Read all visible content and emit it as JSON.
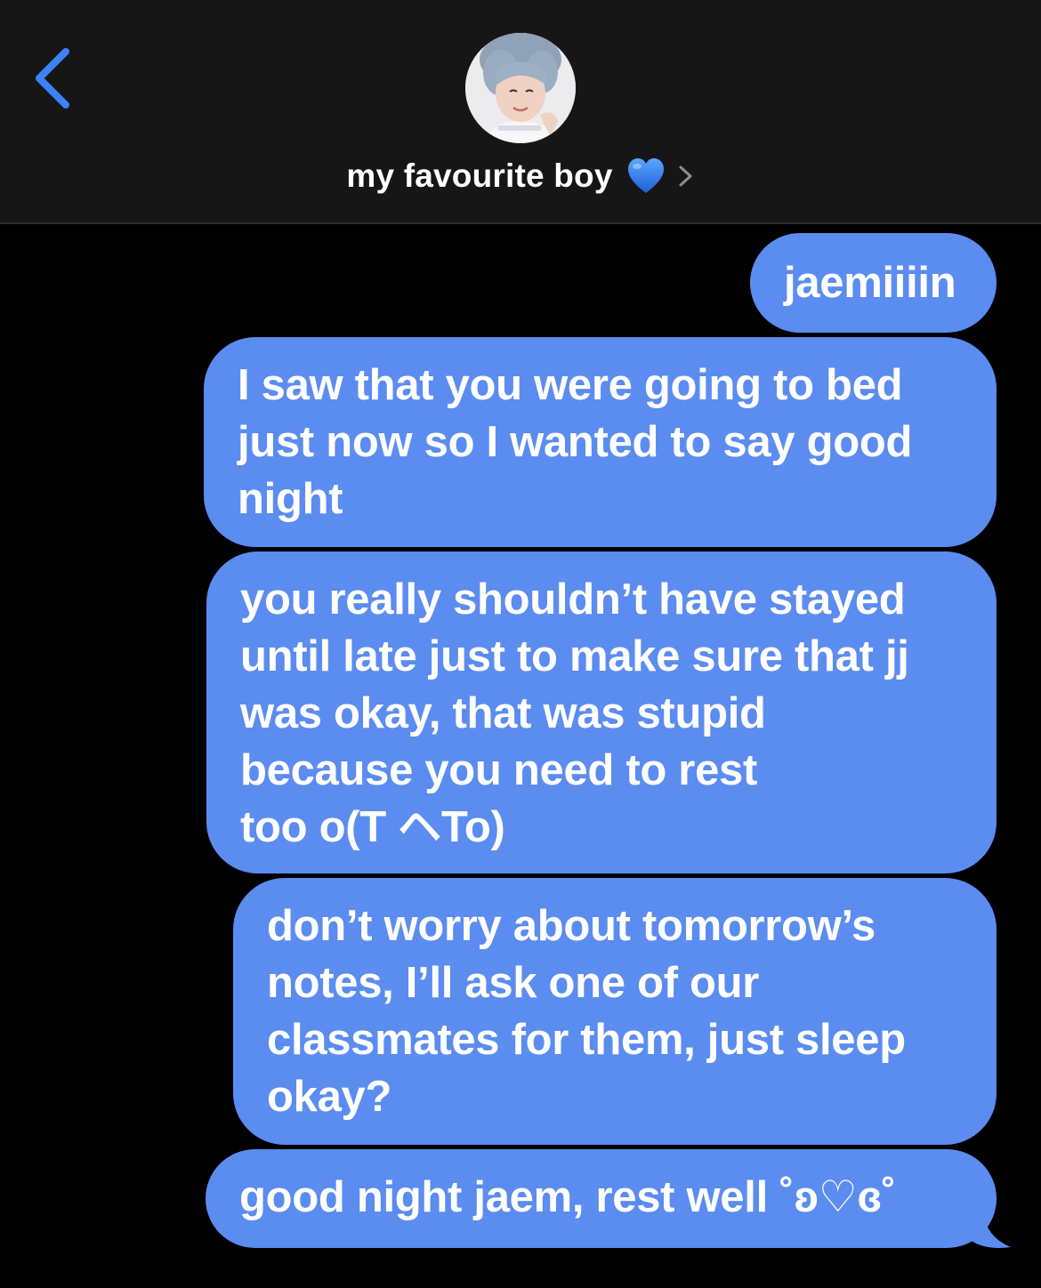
{
  "colors": {
    "header_background": "#161616",
    "background": "#000000",
    "accent": "#3b82f6",
    "sent_bubble": "#5b8cf0",
    "text": "#ffffff"
  },
  "header": {
    "back_icon": "chevron-left-icon",
    "avatar_icon": "contact-avatar",
    "contact_name": "my favourite boy",
    "contact_emoji": "💙",
    "details_icon": "chevron-right-icon"
  },
  "messages": [
    {
      "sender": "me",
      "text": "jaemiiiin"
    },
    {
      "sender": "me",
      "text": "I saw that you were going to bed\njust now so I wanted to say good\nnight"
    },
    {
      "sender": "me",
      "text": "you really shouldn’t have stayed\nuntil late just to make sure that jj\nwas okay, that was stupid\nbecause you need to rest\ntoo o(T ヘTo)"
    },
    {
      "sender": "me",
      "text": "don’t worry about tomorrow’s\nnotes, I’ll ask one of our\nclassmates for them, just sleep\nokay?"
    },
    {
      "sender": "me",
      "text": "good night jaem, rest well ˚ʚ♡ɞ˚"
    }
  ]
}
